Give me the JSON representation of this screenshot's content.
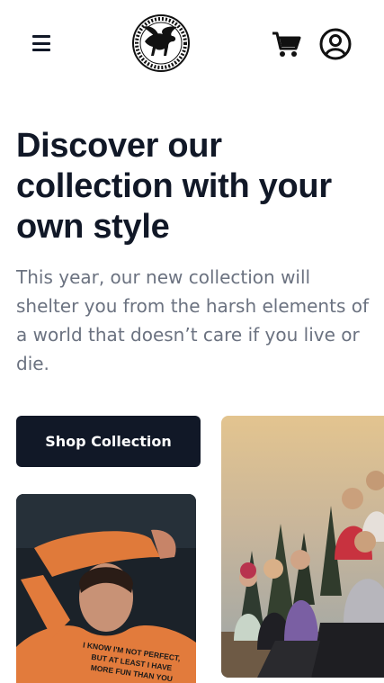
{
  "header": {
    "menu_icon": "hamburger-menu-icon",
    "logo": "pegasus-logo",
    "cart_icon": "shopping-cart-icon",
    "account_icon": "user-circle-icon"
  },
  "hero": {
    "title": "Discover our collection with your own style",
    "description": "This year, our new collection will shelter you from the harsh elements of a world that doesn’t care if you live or die."
  },
  "cta": {
    "shop_label": "Shop Collection"
  },
  "images": {
    "left_shirt_text": [
      "I KNOW I'M NOT PERFECT,",
      "BUT AT LEAST I HAVE",
      "MORE FUN THAN YOU"
    ]
  },
  "colors": {
    "primary_dark": "#111827",
    "muted_text": "#6b7280",
    "background": "#ffffff"
  }
}
